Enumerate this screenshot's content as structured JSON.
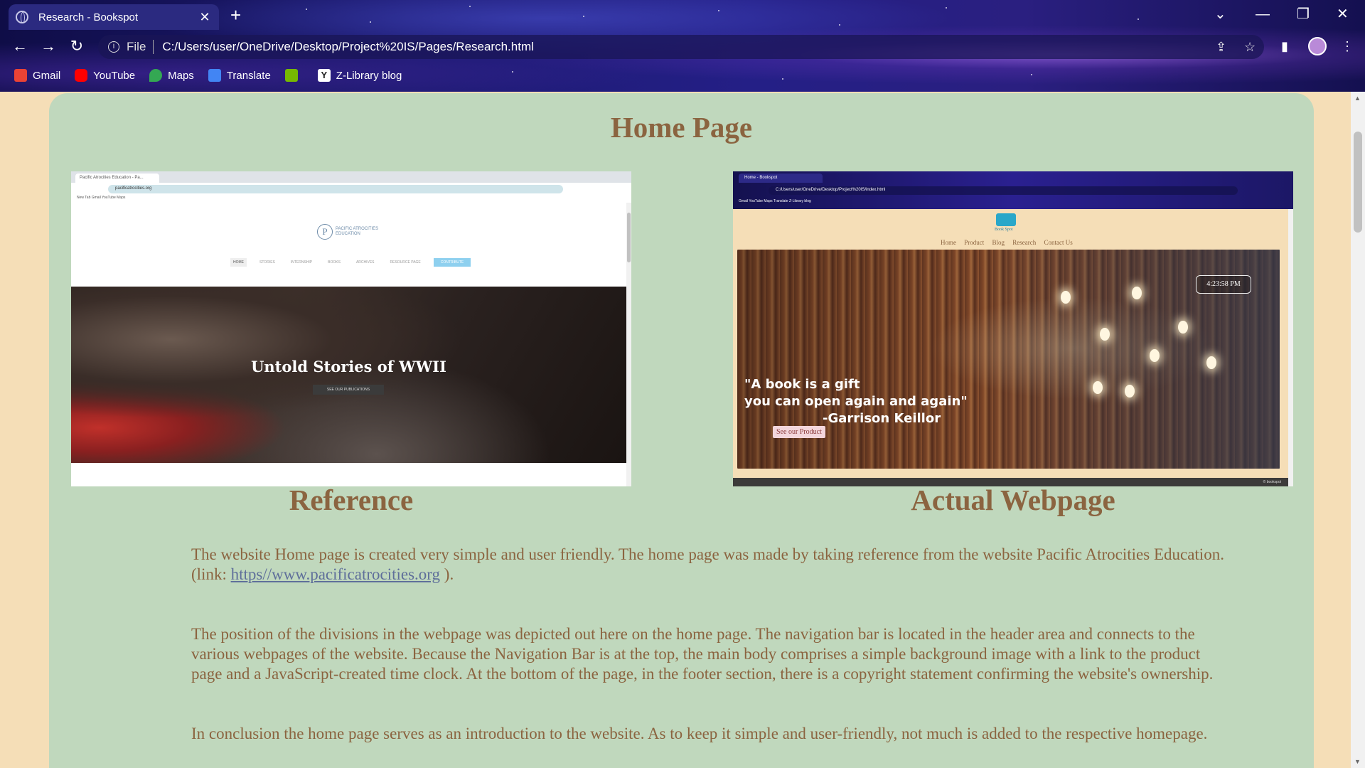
{
  "browser": {
    "tab_title": "Research - Bookspot",
    "new_tab_label": "+",
    "address_scheme": "File",
    "address_url": "C:/Users/user/OneDrive/Desktop/Project%20IS/Pages/Research.html",
    "bookmarks": [
      {
        "label": "Gmail",
        "icon": "gmail-icon",
        "color": "#ea4335"
      },
      {
        "label": "YouTube",
        "icon": "youtube-icon",
        "color": "#ff0000"
      },
      {
        "label": "Maps",
        "icon": "maps-icon",
        "color": "#34a853"
      },
      {
        "label": "Translate",
        "icon": "translate-icon",
        "color": "#4285f4"
      },
      {
        "label": "",
        "icon": "nvidia-icon",
        "color": "#76b900"
      },
      {
        "label": "Z-Library blog",
        "icon": "zlibrary-icon",
        "color": "#ffffff"
      }
    ]
  },
  "page": {
    "heading": "Home Page",
    "caption_reference": "Reference",
    "caption_actual": "Actual Webpage",
    "para1_text": "The website Home page is created very simple and user friendly. The home page was made by taking reference from the website Pacific Atrocities Education.",
    "para1_link_prefix": "(link: ",
    "para1_link": "https//www.pacificatrocities.org",
    "para1_link_suffix": " ).",
    "para2": "The position of the divisions in the webpage was depicted out here on the home page. The navigation bar is located in the header area and connects to the various webpages of the website. Because the Navigation Bar is at the top, the main body comprises a simple background image with a link to the product page and a JavaScript-created time clock. At the bottom of the page, in the footer section, there is a copyright statement confirming the website's ownership.",
    "para3": "In conclusion the home page serves as an introduction to the website. As to keep it simple and user-friendly, not much is added to the respective homepage."
  },
  "reference_shot": {
    "tab_title": "Pacific Atrocities Education - Pa...",
    "url": "pacificatrocities.org",
    "bookmarks": "New Tab   Gmail   YouTube   Maps",
    "logo_mark": "P",
    "logo_text": "PACIFIC ATROCITIES EDUCATION",
    "nav": [
      "HOME",
      "STORIES",
      "INTERNSHIP",
      "BOOKS",
      "ARCHIVES",
      "RESOURCE PAGE",
      "CONTRIBUTE"
    ],
    "hero_title": "Untold Stories of WWII",
    "hero_button": "SEE OUR PUBLICATIONS"
  },
  "actual_shot": {
    "tab_title": "Home - Bookspot",
    "url": "C:/Users/user/OneDrive/Desktop/Project%20IS/index.html",
    "bookmarks": "Gmail   YouTube   Maps   Translate   Z-Library blog",
    "logo_text": "Book Spot",
    "nav": [
      "Home",
      "Product",
      "Blog",
      "Research",
      "Contact Us"
    ],
    "clock": "4:23:58 PM",
    "quote_line1": "\"A book is a gift",
    "quote_line2": "you can open again and again\"",
    "quote_line3": "-Garrison Keillor",
    "product_button": "See our Product",
    "footer": "© bookspot"
  }
}
